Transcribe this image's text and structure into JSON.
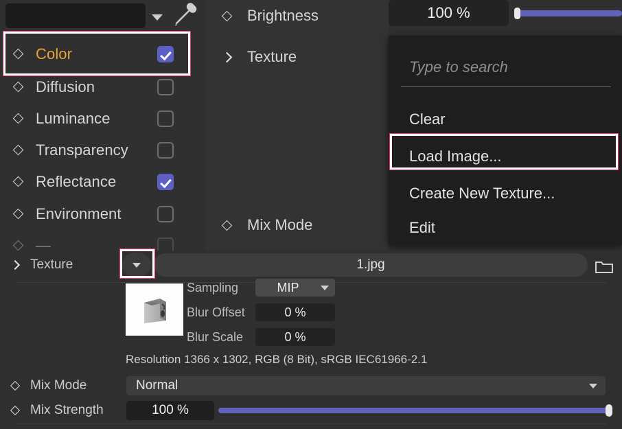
{
  "color_swatch": {
    "name": "color-swatch",
    "fill": "#1b1b1b",
    "caret_icon": "chevron-down-icon",
    "picker_icon": "eyedropper-icon"
  },
  "channels": [
    {
      "label": "Color",
      "checked": true,
      "active": true,
      "icon": "diamond-keyframe-icon"
    },
    {
      "label": "Diffusion",
      "checked": false,
      "active": false,
      "icon": "diamond-keyframe-icon"
    },
    {
      "label": "Luminance",
      "checked": false,
      "active": false,
      "icon": "diamond-keyframe-icon"
    },
    {
      "label": "Transparency",
      "checked": false,
      "active": false,
      "icon": "diamond-keyframe-icon"
    },
    {
      "label": "Reflectance",
      "checked": true,
      "active": false,
      "icon": "diamond-keyframe-icon"
    },
    {
      "label": "Environment",
      "checked": false,
      "active": false,
      "icon": "diamond-keyframe-icon"
    }
  ],
  "middle": {
    "brightness_label": "Brightness",
    "brightness_value": "100 %",
    "brightness_slider_percent": 100,
    "texture_label": "Texture",
    "texture_chevron_icon": "chevron-right-icon",
    "mix_mode_label": "Mix Mode"
  },
  "texture_menu": {
    "search_placeholder": "Type to search",
    "items": [
      {
        "label": "Clear",
        "highlighted": false
      },
      {
        "label": "Load Image...",
        "highlighted": true
      },
      {
        "label": "Create New Texture...",
        "highlighted": false
      },
      {
        "label": "Edit",
        "highlighted": false
      }
    ]
  },
  "lower": {
    "texture_label": "Texture",
    "texture_chevron_icon": "chevron-right-icon",
    "dropdown_icon": "triangle-down-icon",
    "file_name": "1.jpg",
    "folder_icon": "folder-icon",
    "thumbnail_alt": "texture-thumbnail",
    "properties": [
      {
        "label": "Sampling",
        "value": "MIP",
        "type": "combo"
      },
      {
        "label": "Blur Offset",
        "value": "0 %",
        "type": "number"
      },
      {
        "label": "Blur Scale",
        "value": "0 %",
        "type": "number"
      }
    ],
    "resolution_text": "Resolution 1366 x 1302, RGB (8 Bit), sRGB IEC61966-2.1",
    "mix_mode_label": "Mix Mode",
    "mix_mode_value": "Normal",
    "mix_strength_label": "Mix Strength",
    "mix_strength_value": "100 %",
    "mix_strength_percent": 100
  },
  "colors": {
    "accent_check": "#5c5fc4",
    "slider_fill": "#5f64b8",
    "active_label": "#e8a33d",
    "highlight_box": "#ef3b63",
    "panel_bg": "#303030",
    "menu_bg": "#1e1e1e"
  }
}
